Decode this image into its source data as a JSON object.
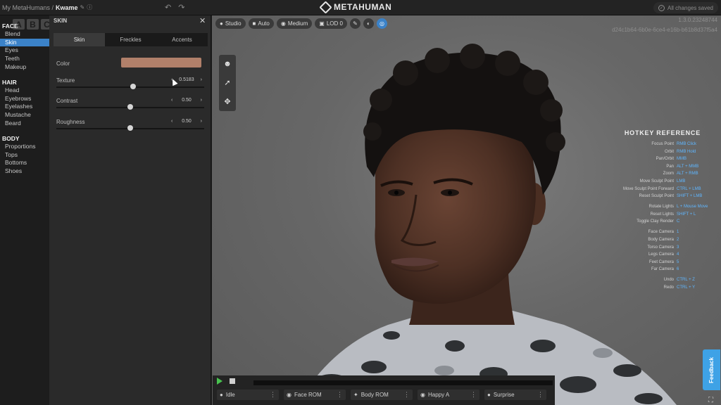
{
  "topbar": {
    "breadcrumb_root": "My MetaHumans /",
    "breadcrumb_name": "Kwame",
    "logo": "METAHUMAN",
    "saved_text": "All changes saved"
  },
  "leftnav": {
    "abc": [
      "A",
      "B",
      "C"
    ],
    "face_header": "FACE",
    "face_items": [
      "Blend",
      "Skin",
      "Eyes",
      "Teeth",
      "Makeup"
    ],
    "hair_header": "HAIR",
    "hair_items": [
      "Head",
      "Eyebrows",
      "Eyelashes",
      "Mustache",
      "Beard"
    ],
    "body_header": "BODY",
    "body_items": [
      "Proportions",
      "Tops",
      "Bottoms",
      "Shoes"
    ],
    "selected": "Skin"
  },
  "panel": {
    "title": "SKIN",
    "tabs": [
      "Skin",
      "Freckles",
      "Accents"
    ],
    "active_tab": "Skin",
    "color_label": "Color",
    "color_value": "#b1806a",
    "texture_label": "Texture",
    "texture_value": "0.5183",
    "contrast_label": "Contrast",
    "contrast_value": "0.50",
    "roughness_label": "Roughness",
    "roughness_value": "0.50"
  },
  "viewport": {
    "toolbar": [
      "Studio",
      "Auto",
      "Medium",
      "LOD 0"
    ],
    "version_line1": "1.3.0.23248744",
    "version_line2": "d24c1b64-6b0e-6ce4-e16b-b61b8d37f5a4",
    "hotkeys_title": "HOTKEY REFERENCE",
    "hotkeys": [
      {
        "action": "Focus Point",
        "key": "RMB Click"
      },
      {
        "action": "Orbit",
        "key": "RMB Hold"
      },
      {
        "action": "Pan/Orbit",
        "key": "MMB"
      },
      {
        "action": "Pan",
        "key": "ALT + MMB"
      },
      {
        "action": "Zoom",
        "key": "ALT + RMB"
      },
      {
        "action": "Move Sculpt Point",
        "key": "LMB"
      },
      {
        "action": "Move Sculpt Point Forward",
        "key": "CTRL + LMB"
      },
      {
        "action": "Reset Sculpt Point",
        "key": "SHIFT + LMB"
      },
      {
        "action": "Rotate Lights",
        "key": "L + Mouse Move"
      },
      {
        "action": "Reset Lights",
        "key": "SHIFT + L"
      },
      {
        "action": "Toggle Clay Render",
        "key": "C"
      },
      {
        "action": "Face Camera",
        "key": "1"
      },
      {
        "action": "Body Camera",
        "key": "2"
      },
      {
        "action": "Torso Camera",
        "key": "3"
      },
      {
        "action": "Legs Camera",
        "key": "4"
      },
      {
        "action": "Feet Camera",
        "key": "5"
      },
      {
        "action": "Far Camera",
        "key": "6"
      },
      {
        "action": "Undo",
        "key": "CTRL + Z"
      },
      {
        "action": "Redo",
        "key": "CTRL + Y"
      }
    ],
    "feedback": "Feedback"
  },
  "player": {
    "animations": [
      "Idle",
      "Face ROM",
      "Body ROM",
      "Happy A",
      "Surprise"
    ]
  }
}
